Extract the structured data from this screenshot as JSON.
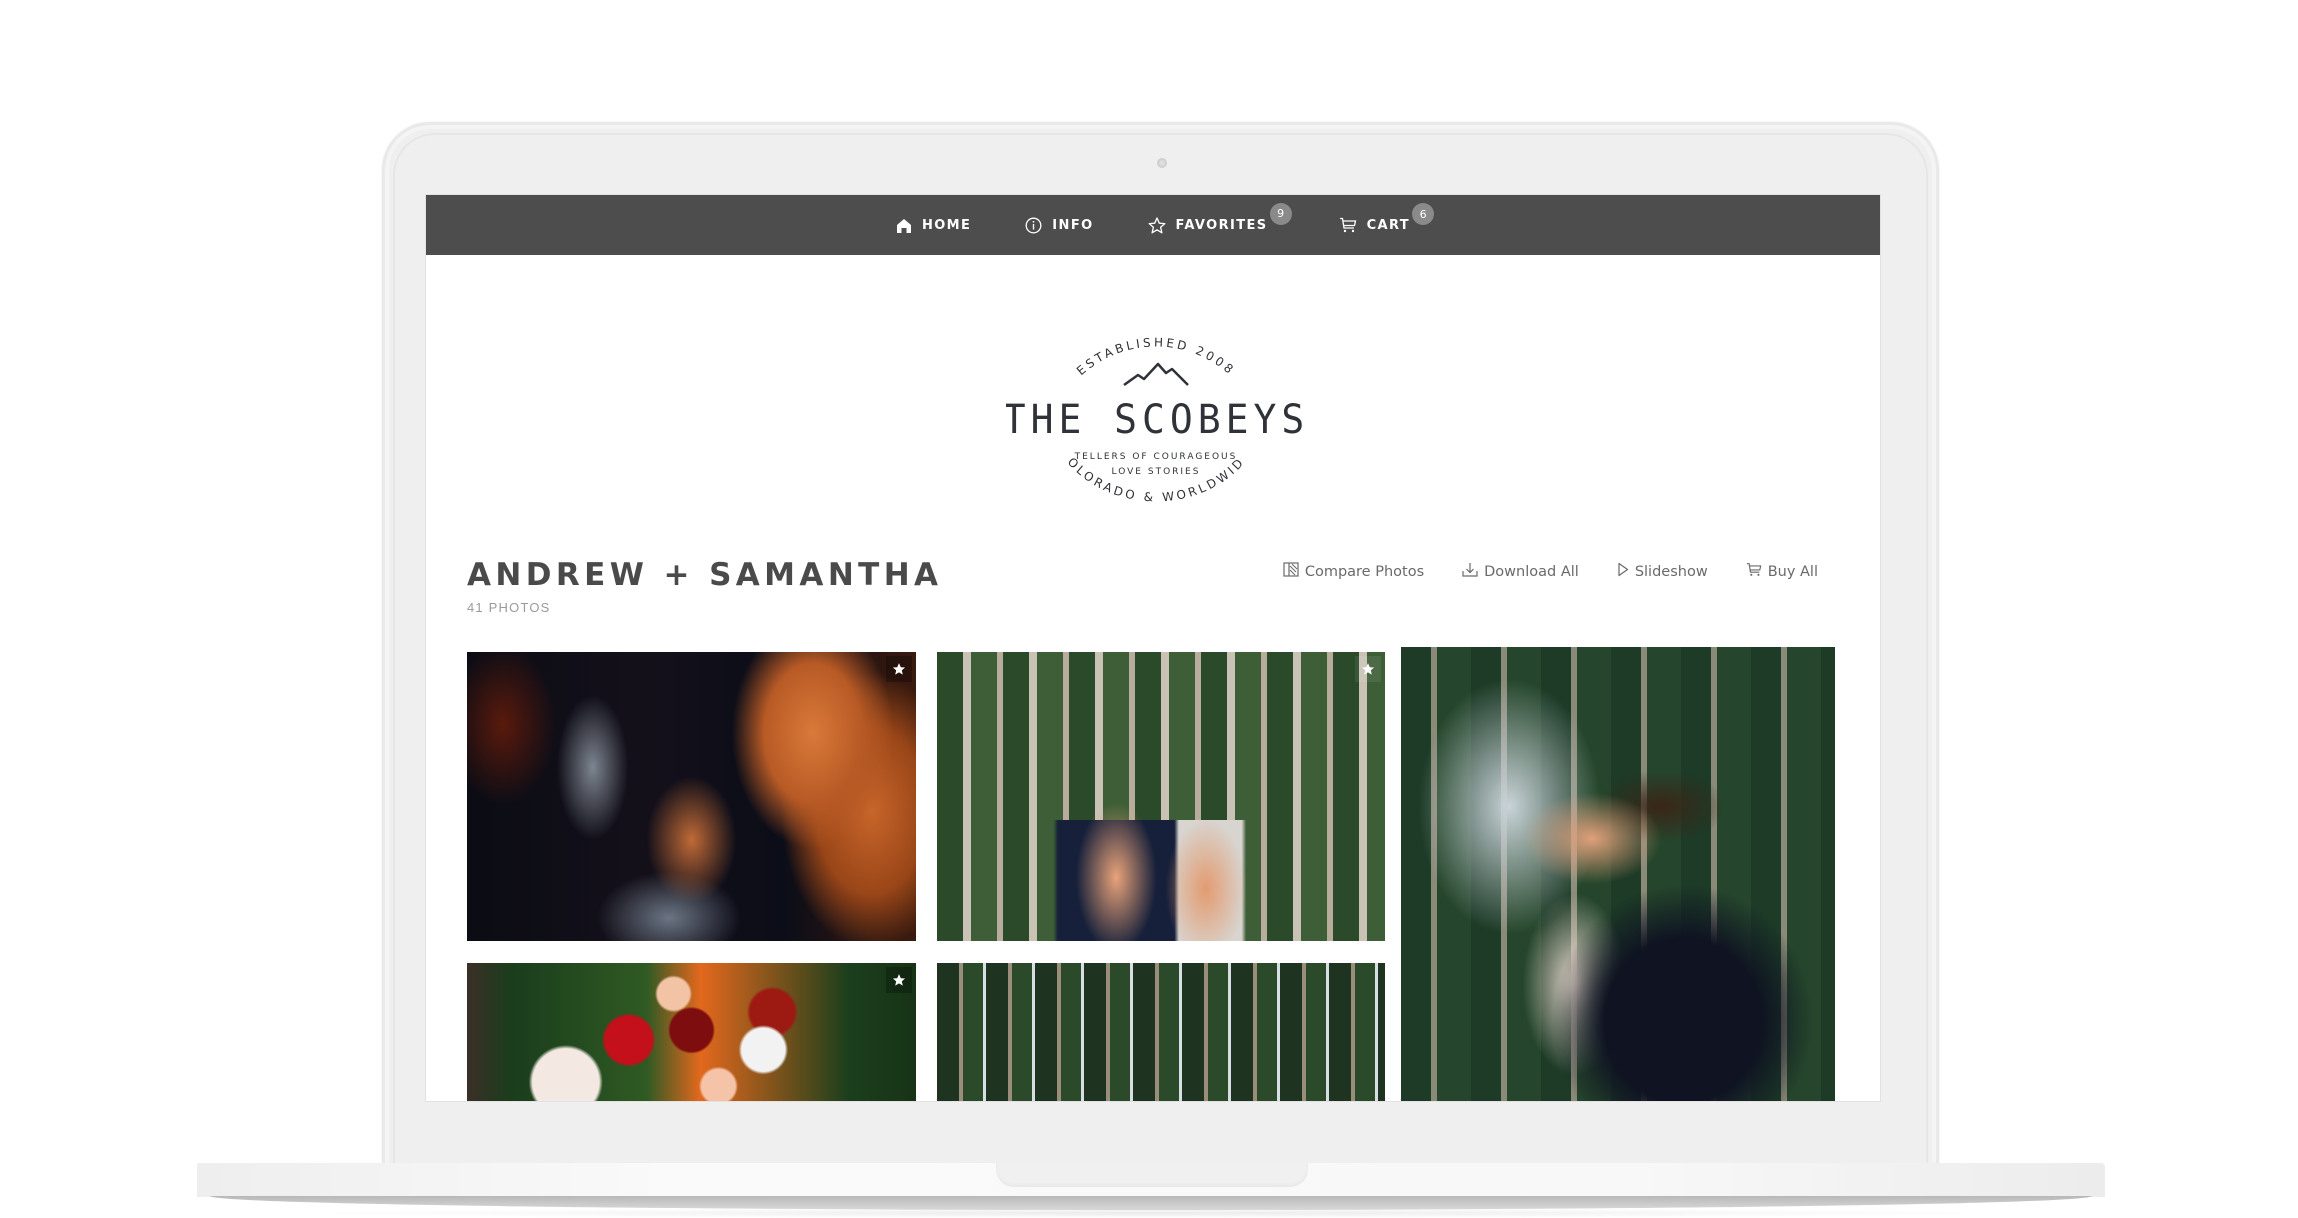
{
  "nav": {
    "items": [
      {
        "label": "HOME",
        "icon": "home-icon"
      },
      {
        "label": "INFO",
        "icon": "info-icon"
      },
      {
        "label": "FAVORITES",
        "icon": "star-icon",
        "badge": "9"
      },
      {
        "label": "CART",
        "icon": "cart-icon",
        "badge": "6"
      }
    ]
  },
  "logo": {
    "top_arc": "ESTABLISHED 2008",
    "name": "THE SCOBEYS",
    "tagline_line1": "TELLERS OF COURAGEOUS",
    "tagline_line2": "LOVE STORIES",
    "bottom_arc": "COLORADO & WORLDWIDE"
  },
  "gallery": {
    "title": "ANDREW + SAMANTHA",
    "count": "41 PHOTOS",
    "actions": [
      {
        "label": "Compare Photos",
        "icon": "compare-icon"
      },
      {
        "label": "Download All",
        "icon": "download-icon"
      },
      {
        "label": "Slideshow",
        "icon": "play-icon"
      },
      {
        "label": "Buy All",
        "icon": "cart-icon"
      }
    ],
    "photos": [
      {
        "subject": "bride applying lipstick",
        "favorited": true
      },
      {
        "subject": "couple standing in aspen grove",
        "favorited": true
      },
      {
        "subject": "couple embracing in aspen forest",
        "favorited": false
      },
      {
        "subject": "bridal bouquet",
        "favorited": true
      },
      {
        "subject": "aspen forest",
        "favorited": false
      }
    ]
  }
}
